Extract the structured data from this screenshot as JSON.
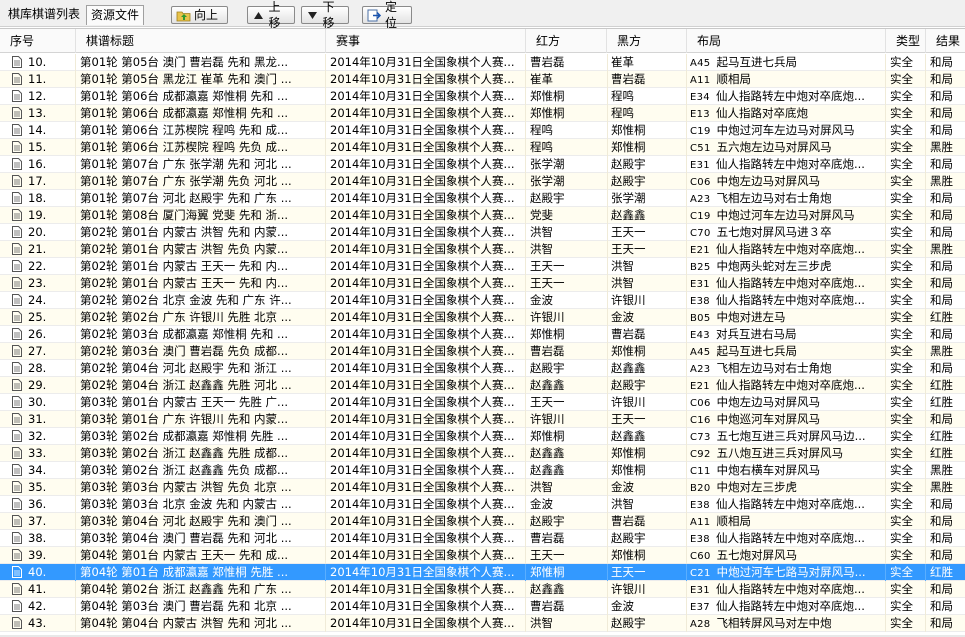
{
  "toolbar": {
    "tab_list": "棋库棋谱列表",
    "tab_resources": "资源文件",
    "btn_up": "向上",
    "btn_move_up": "上移",
    "btn_move_down": "下移",
    "btn_locate": "定位",
    "icons": {
      "up": "folder-up-icon",
      "move_up": "arrow-up-icon",
      "move_down": "arrow-down-icon",
      "locate": "locate-icon"
    }
  },
  "columns": {
    "num": "序号",
    "title": "棋谱标题",
    "event": "赛事",
    "red": "红方",
    "black": "黑方",
    "opening": "布局",
    "type": "类型",
    "result": "结果"
  },
  "selected_row_num": "40.",
  "colors": {
    "row_alt": "#fffdf0",
    "selected": "#3399ff",
    "header": "#fafafa"
  },
  "rows": [
    {
      "num": "10.",
      "title": "第01轮 第05台 澳门 曹岩磊 先和 黑龙...",
      "event": "2014年10月31日全国象棋个人赛...",
      "red": "曹岩磊",
      "black": "崔革",
      "code": "A45",
      "opening": "起马互进七兵局",
      "type": "实全",
      "result": "和局"
    },
    {
      "num": "11.",
      "title": "第01轮 第05台 黑龙江 崔革 先和 澳门 ...",
      "event": "2014年10月31日全国象棋个人赛...",
      "red": "崔革",
      "black": "曹岩磊",
      "code": "A11",
      "opening": "顺相局",
      "type": "实全",
      "result": "和局"
    },
    {
      "num": "12.",
      "title": "第01轮 第06台 成都瀛嘉 郑惟桐 先和 ...",
      "event": "2014年10月31日全国象棋个人赛...",
      "red": "郑惟桐",
      "black": "程鸣",
      "code": "E34",
      "opening": "仙人指路转左中炮对卒底炮...",
      "type": "实全",
      "result": "和局"
    },
    {
      "num": "13.",
      "title": "第01轮 第06台 成都瀛嘉 郑惟桐 先和 ...",
      "event": "2014年10月31日全国象棋个人赛...",
      "red": "郑惟桐",
      "black": "程鸣",
      "code": "E13",
      "opening": "仙人指路对卒底炮",
      "type": "实全",
      "result": "和局"
    },
    {
      "num": "14.",
      "title": "第01轮 第06台 江苏楔院 程鸣 先和 成...",
      "event": "2014年10月31日全国象棋个人赛...",
      "red": "程鸣",
      "black": "郑惟桐",
      "code": "C19",
      "opening": "中炮过河车左边马对屏风马",
      "type": "实全",
      "result": "和局"
    },
    {
      "num": "15.",
      "title": "第01轮 第06台 江苏楔院 程鸣 先负 成...",
      "event": "2014年10月31日全国象棋个人赛...",
      "red": "程鸣",
      "black": "郑惟桐",
      "code": "C51",
      "opening": "五六炮左边马对屏风马",
      "type": "实全",
      "result": "黑胜"
    },
    {
      "num": "16.",
      "title": "第01轮 第07台 广东 张学潮 先和 河北 ...",
      "event": "2014年10月31日全国象棋个人赛...",
      "red": "张学潮",
      "black": "赵殿宇",
      "code": "E31",
      "opening": "仙人指路转左中炮对卒底炮...",
      "type": "实全",
      "result": "和局"
    },
    {
      "num": "17.",
      "title": "第01轮 第07台 广东 张学潮 先负 河北 ...",
      "event": "2014年10月31日全国象棋个人赛...",
      "red": "张学潮",
      "black": "赵殿宇",
      "code": "C06",
      "opening": "中炮左边马对屏风马",
      "type": "实全",
      "result": "黑胜"
    },
    {
      "num": "18.",
      "title": "第01轮 第07台 河北 赵殿宇 先和 广东 ...",
      "event": "2014年10月31日全国象棋个人赛...",
      "red": "赵殿宇",
      "black": "张学潮",
      "code": "A23",
      "opening": "飞相左边马对右士角炮",
      "type": "实全",
      "result": "和局"
    },
    {
      "num": "19.",
      "title": "第01轮 第08台 厦门海翼 党斐 先和 浙...",
      "event": "2014年10月31日全国象棋个人赛...",
      "red": "党斐",
      "black": "赵鑫鑫",
      "code": "C19",
      "opening": "中炮过河车左边马对屏风马",
      "type": "实全",
      "result": "和局"
    },
    {
      "num": "20.",
      "title": "第02轮 第01台 内蒙古 洪智 先和 内蒙...",
      "event": "2014年10月31日全国象棋个人赛...",
      "red": "洪智",
      "black": "王天一",
      "code": "C70",
      "opening": "五七炮对屏风马进３卒",
      "type": "实全",
      "result": "和局"
    },
    {
      "num": "21.",
      "title": "第02轮 第01台 内蒙古 洪智 先负 内蒙...",
      "event": "2014年10月31日全国象棋个人赛...",
      "red": "洪智",
      "black": "王天一",
      "code": "E21",
      "opening": "仙人指路转左中炮对卒底炮...",
      "type": "实全",
      "result": "黑胜"
    },
    {
      "num": "22.",
      "title": "第02轮 第01台 内蒙古 王天一 先和 内...",
      "event": "2014年10月31日全国象棋个人赛...",
      "red": "王天一",
      "black": "洪智",
      "code": "B25",
      "opening": "中炮两头蛇对左三步虎",
      "type": "实全",
      "result": "和局"
    },
    {
      "num": "23.",
      "title": "第02轮 第01台 内蒙古 王天一 先和 内...",
      "event": "2014年10月31日全国象棋个人赛...",
      "red": "王天一",
      "black": "洪智",
      "code": "E31",
      "opening": "仙人指路转左中炮对卒底炮...",
      "type": "实全",
      "result": "和局"
    },
    {
      "num": "24.",
      "title": "第02轮 第02台 北京 金波 先和 广东 许...",
      "event": "2014年10月31日全国象棋个人赛...",
      "red": "金波",
      "black": "许银川",
      "code": "E38",
      "opening": "仙人指路转左中炮对卒底炮...",
      "type": "实全",
      "result": "和局"
    },
    {
      "num": "25.",
      "title": "第02轮 第02台 广东 许银川 先胜 北京 ...",
      "event": "2014年10月31日全国象棋个人赛...",
      "red": "许银川",
      "black": "金波",
      "code": "B05",
      "opening": "中炮对进左马",
      "type": "实全",
      "result": "红胜"
    },
    {
      "num": "26.",
      "title": "第02轮 第03台 成都瀛嘉 郑惟桐 先和 ...",
      "event": "2014年10月31日全国象棋个人赛...",
      "red": "郑惟桐",
      "black": "曹岩磊",
      "code": "E43",
      "opening": "对兵互进右马局",
      "type": "实全",
      "result": "和局"
    },
    {
      "num": "27.",
      "title": "第02轮 第03台 澳门 曹岩磊 先负 成都...",
      "event": "2014年10月31日全国象棋个人赛...",
      "red": "曹岩磊",
      "black": "郑惟桐",
      "code": "A45",
      "opening": "起马互进七兵局",
      "type": "实全",
      "result": "黑胜"
    },
    {
      "num": "28.",
      "title": "第02轮 第04台 河北 赵殿宇 先和 浙江 ...",
      "event": "2014年10月31日全国象棋个人赛...",
      "red": "赵殿宇",
      "black": "赵鑫鑫",
      "code": "A23",
      "opening": "飞相左边马对右士角炮",
      "type": "实全",
      "result": "和局"
    },
    {
      "num": "29.",
      "title": "第02轮 第04台 浙江 赵鑫鑫 先胜 河北 ...",
      "event": "2014年10月31日全国象棋个人赛...",
      "red": "赵鑫鑫",
      "black": "赵殿宇",
      "code": "E21",
      "opening": "仙人指路转左中炮对卒底炮...",
      "type": "实全",
      "result": "红胜"
    },
    {
      "num": "30.",
      "title": "第03轮 第01台 内蒙古 王天一 先胜 广...",
      "event": "2014年10月31日全国象棋个人赛...",
      "red": "王天一",
      "black": "许银川",
      "code": "C06",
      "opening": "中炮左边马对屏风马",
      "type": "实全",
      "result": "红胜"
    },
    {
      "num": "31.",
      "title": "第03轮 第01台 广东 许银川 先和 内蒙...",
      "event": "2014年10月31日全国象棋个人赛...",
      "red": "许银川",
      "black": "王天一",
      "code": "C16",
      "opening": "中炮巡河车对屏风马",
      "type": "实全",
      "result": "和局"
    },
    {
      "num": "32.",
      "title": "第03轮 第02台 成都瀛嘉 郑惟桐 先胜 ...",
      "event": "2014年10月31日全国象棋个人赛...",
      "red": "郑惟桐",
      "black": "赵鑫鑫",
      "code": "C73",
      "opening": "五七炮互进三兵对屏风马边...",
      "type": "实全",
      "result": "红胜"
    },
    {
      "num": "33.",
      "title": "第03轮 第02台 浙江 赵鑫鑫 先胜 成都...",
      "event": "2014年10月31日全国象棋个人赛...",
      "red": "赵鑫鑫",
      "black": "郑惟桐",
      "code": "C92",
      "opening": "五八炮互进三兵对屏风马",
      "type": "实全",
      "result": "红胜"
    },
    {
      "num": "34.",
      "title": "第03轮 第02台 浙江 赵鑫鑫 先负 成都...",
      "event": "2014年10月31日全国象棋个人赛...",
      "red": "赵鑫鑫",
      "black": "郑惟桐",
      "code": "C11",
      "opening": "中炮右横车对屏风马",
      "type": "实全",
      "result": "黑胜"
    },
    {
      "num": "35.",
      "title": "第03轮 第03台 内蒙古 洪智 先负 北京 ...",
      "event": "2014年10月31日全国象棋个人赛...",
      "red": "洪智",
      "black": "金波",
      "code": "B20",
      "opening": "中炮对左三步虎",
      "type": "实全",
      "result": "黑胜"
    },
    {
      "num": "36.",
      "title": "第03轮 第03台 北京 金波 先和 内蒙古 ...",
      "event": "2014年10月31日全国象棋个人赛...",
      "red": "金波",
      "black": "洪智",
      "code": "E38",
      "opening": "仙人指路转左中炮对卒底炮...",
      "type": "实全",
      "result": "和局"
    },
    {
      "num": "37.",
      "title": "第03轮 第04台 河北 赵殿宇 先和 澳门 ...",
      "event": "2014年10月31日全国象棋个人赛...",
      "red": "赵殿宇",
      "black": "曹岩磊",
      "code": "A11",
      "opening": "顺相局",
      "type": "实全",
      "result": "和局"
    },
    {
      "num": "38.",
      "title": "第03轮 第04台 澳门 曹岩磊 先和 河北 ...",
      "event": "2014年10月31日全国象棋个人赛...",
      "red": "曹岩磊",
      "black": "赵殿宇",
      "code": "E38",
      "opening": "仙人指路转左中炮对卒底炮...",
      "type": "实全",
      "result": "和局"
    },
    {
      "num": "39.",
      "title": "第04轮 第01台 内蒙古 王天一 先和 成...",
      "event": "2014年10月31日全国象棋个人赛...",
      "red": "王天一",
      "black": "郑惟桐",
      "code": "C60",
      "opening": "五七炮对屏风马",
      "type": "实全",
      "result": "和局"
    },
    {
      "num": "40.",
      "title": "第04轮 第01台 成都瀛嘉 郑惟桐 先胜 ...",
      "event": "2014年10月31日全国象棋个人赛...",
      "red": "郑惟桐",
      "black": "王天一",
      "code": "C21",
      "opening": "中炮过河车七路马对屏风马...",
      "type": "实全",
      "result": "红胜"
    },
    {
      "num": "41.",
      "title": "第04轮 第02台 浙江 赵鑫鑫 先和 广东 ...",
      "event": "2014年10月31日全国象棋个人赛...",
      "red": "赵鑫鑫",
      "black": "许银川",
      "code": "E31",
      "opening": "仙人指路转左中炮对卒底炮...",
      "type": "实全",
      "result": "和局"
    },
    {
      "num": "42.",
      "title": "第04轮 第03台 澳门 曹岩磊 先和 北京 ...",
      "event": "2014年10月31日全国象棋个人赛...",
      "red": "曹岩磊",
      "black": "金波",
      "code": "E37",
      "opening": "仙人指路转左中炮对卒底炮...",
      "type": "实全",
      "result": "和局"
    },
    {
      "num": "43.",
      "title": "第04轮 第04台 内蒙古 洪智 先和 河北 ...",
      "event": "2014年10月31日全国象棋个人赛...",
      "red": "洪智",
      "black": "赵殿宇",
      "code": "A28",
      "opening": "飞相转屏风马对左中炮",
      "type": "实全",
      "result": "和局"
    }
  ]
}
